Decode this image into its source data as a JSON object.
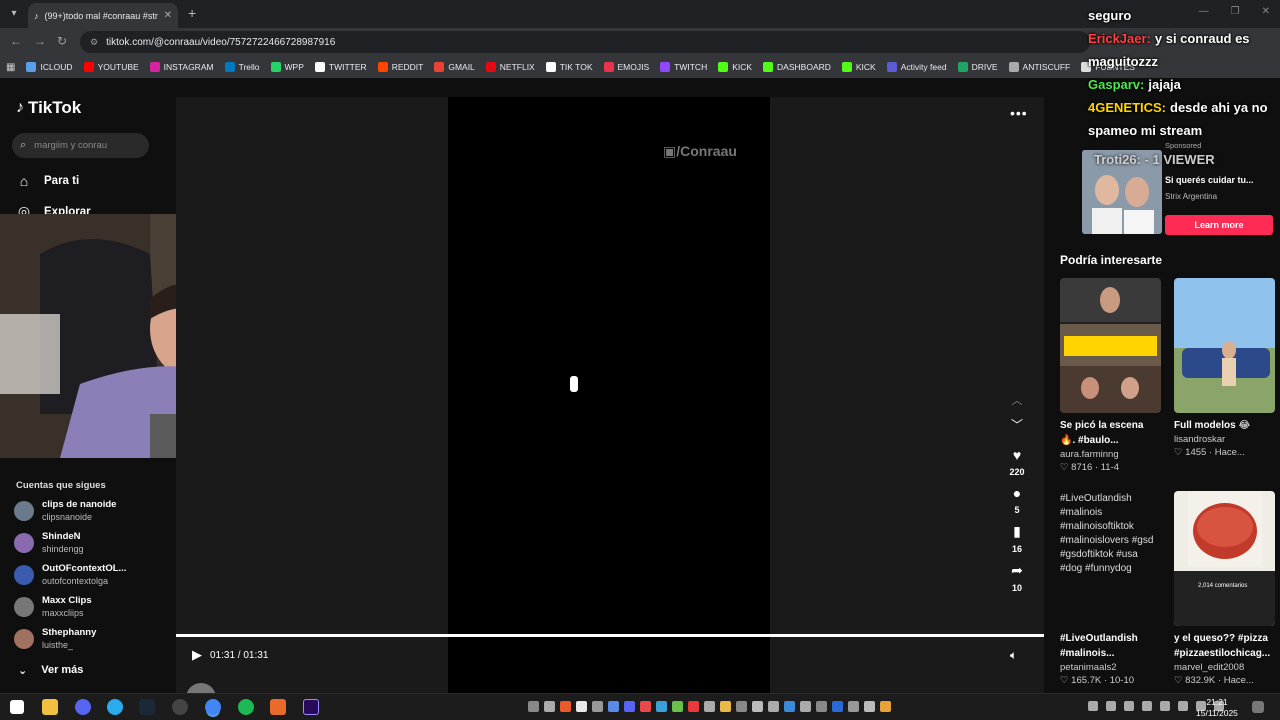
{
  "browser": {
    "tab_title": "(99+)todo mal #conraau #strea",
    "url": "tiktok.com/@conraau/video/7572722466728987916",
    "bookmarks": [
      {
        "label": "ICLOUD",
        "color": "#5aa0e8"
      },
      {
        "label": "YOUTUBE",
        "color": "#ff0000"
      },
      {
        "label": "INSTAGRAM",
        "color": "#d6249f"
      },
      {
        "label": "Trello",
        "color": "#0079bf"
      },
      {
        "label": "WPP",
        "color": "#25d366"
      },
      {
        "label": "TWITTER",
        "color": "#ffffff"
      },
      {
        "label": "REDDIT",
        "color": "#ff4500"
      },
      {
        "label": "GMAIL",
        "color": "#ea4335"
      },
      {
        "label": "NETFLIX",
        "color": "#e50914"
      },
      {
        "label": "TIK TOK",
        "color": "#ffffff"
      },
      {
        "label": "EMOJIS",
        "color": "#e8334a"
      },
      {
        "label": "TWITCH",
        "color": "#9146ff"
      },
      {
        "label": "KICK",
        "color": "#53fc18"
      },
      {
        "label": "DASHBOARD",
        "color": "#53fc18"
      },
      {
        "label": "KICK",
        "color": "#53fc18"
      },
      {
        "label": "Activity feed",
        "color": "#5b5bd6"
      },
      {
        "label": "DRIVE",
        "color": "#1fa463"
      },
      {
        "label": "ANTISCUFF",
        "color": "#aaaaaa"
      },
      {
        "label": "FUENTES",
        "color": "#dddddd"
      }
    ]
  },
  "tiktok": {
    "logo": "TikTok",
    "search_placeholder": "margiim y conrau",
    "nav": {
      "for_you": "Para ti",
      "explore": "Explorar"
    },
    "following_title": "Cuentas que sigues",
    "following": [
      {
        "name": "clips de nanoide",
        "handle": "clipsnanoide",
        "color": "#6b7b8c"
      },
      {
        "name": "ShindeN",
        "handle": "shindengg",
        "color": "#8b6bb0"
      },
      {
        "name": "OutOFcontextOL...",
        "handle": "outofcontextolga",
        "color": "#3b5bb0"
      },
      {
        "name": "Maxx Clips",
        "handle": "maxxcliips",
        "color": "#777777"
      },
      {
        "name": "Sthephanny",
        "handle": "luisthe_",
        "color": "#a07060"
      }
    ],
    "see_more": "Ver más"
  },
  "video": {
    "watermark": "/Conraau",
    "time": "01:31 / 01:31",
    "author": "conraau",
    "progress": 1.0,
    "actions": {
      "likes": "220",
      "comments": "5",
      "saves": "16",
      "shares": "10"
    }
  },
  "overlay": {
    "chat": [
      {
        "user": "",
        "text": "seguro",
        "color": "#ffffff"
      },
      {
        "user": "ErickJaer:",
        "text": "y si conraud es maguitozzz",
        "color": "#ff4040"
      },
      {
        "user": "Gasparv:",
        "text": "jajaja",
        "color": "#4ce84c"
      },
      {
        "user": "4GENETICS:",
        "text": "desde ahi ya no spameo mi stream",
        "color": "#ffd400"
      }
    ],
    "viewer": "Troti26: - 1 VIEWER"
  },
  "ad": {
    "sponsored": "Sponsored",
    "text": "Si querés cuidar tu...",
    "brand": "Strix Argentina",
    "cta": "Learn more"
  },
  "recommended": {
    "title": "Podría interesarte",
    "items": [
      {
        "caption": "Se picó la escena 🔥. #baulo...",
        "user": "aura.farminng",
        "stats": "♡ 8716 · 11-4",
        "img_text": "BAULO SE PRESENTA Y SE LA PICANTEA A COSCU"
      },
      {
        "caption": "Full modelos 😂",
        "user": "lisandroskar",
        "stats": "♡ 1455 · Hace...",
        "img_text": ""
      },
      {
        "caption": "#LiveOutlandish #malinois...",
        "user": "petanimaals2",
        "stats": "♡ 165.7K · 10-10",
        "img_text": "#LiveOutlandish #malinois #malinoisoftiktok #malinoislovers #gsd #gsdoftiktok #usa #dog #funnydog"
      },
      {
        "caption": "y el queso?? #pizza #pizzaestilochicag...",
        "user": "marvel_edit2008",
        "stats": "♡ 832.9K · Hace...",
        "img_text": "2,014 comentarios"
      }
    ]
  },
  "taskbar": {
    "time": "21:21",
    "date": "15/11/2025"
  }
}
